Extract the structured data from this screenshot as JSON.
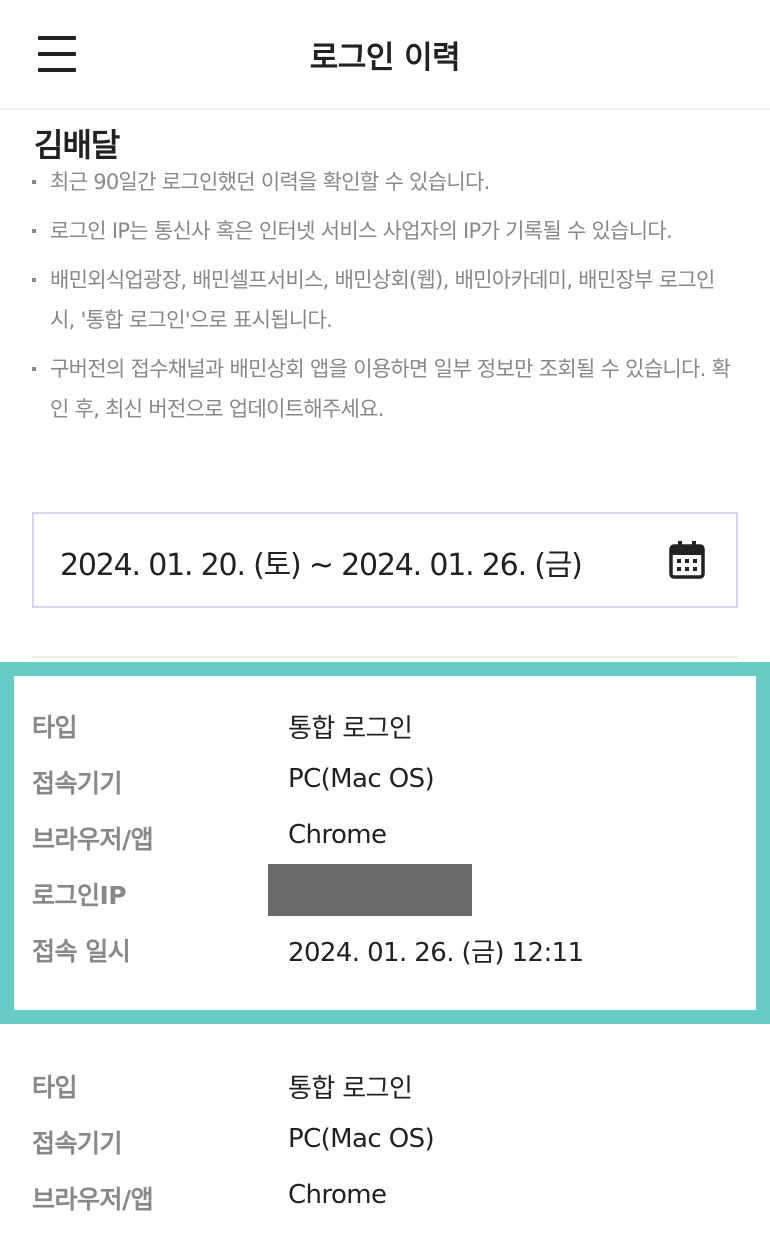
{
  "header": {
    "title": "로그인 이력",
    "menu_icon": "hamburger-menu-icon"
  },
  "user": {
    "name": "김배달"
  },
  "notices": [
    "최근 90일간 로그인했던 이력을 확인할 수 있습니다.",
    "로그인 IP는 통신사 혹은 인터넷 서비스 사업자의 IP가 기록될 수 있습니다.",
    "배민외식업광장, 배민셀프서비스, 배민상회(웹), 배민아카데미, 배민장부 로그인 시, '통합 로그인'으로 표시됩니다.",
    "구버전의 접수채널과 배민상회 앱을 이용하면 일부 정보만 조회될 수 있습니다. 확인 후, 최신 버전으로 업데이트해주세요."
  ],
  "date_range": {
    "value": "2024. 01. 20. (토) ~ 2024. 01. 26. (금)",
    "icon": "calendar-icon"
  },
  "colors": {
    "highlight_border": "#66ccc5",
    "label_gray": "#888888",
    "masked_ip": "#6b6b6b"
  },
  "records": [
    {
      "type_label": "타입",
      "type_value": "통합 로그인",
      "device_label": "접속기기",
      "device_value": "PC(Mac OS)",
      "browser_label": "브라우저/앱",
      "browser_value": "Chrome",
      "ip_label": "로그인IP",
      "time_label": "접속 일시",
      "time_value": "2024. 01. 26. (금) 12:11"
    },
    {
      "type_label": "타입",
      "type_value": "통합 로그인",
      "device_label": "접속기기",
      "device_value": "PC(Mac OS)",
      "browser_label": "브라우저/앱",
      "browser_value": "Chrome"
    }
  ]
}
